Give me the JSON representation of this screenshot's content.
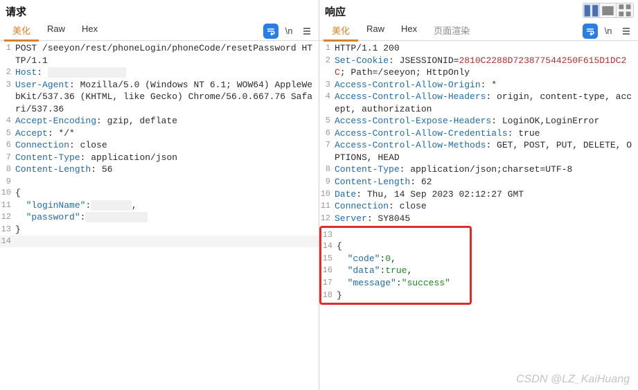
{
  "view_buttons": [
    "split",
    "single",
    "grid"
  ],
  "request": {
    "title": "请求",
    "tabs": [
      "美化",
      "Raw",
      "Hex"
    ],
    "active_tab": 0,
    "lines": [
      [
        {
          "t": "hlit",
          "v": "POST /seeyon/rest/phoneLogin/phoneCode/resetPassword HTTP/1.1"
        }
      ],
      [
        {
          "t": "hname",
          "v": "Host"
        },
        {
          "t": "hlit",
          "v": ": "
        },
        {
          "t": "blur",
          "v": "xxxxxxxxxxxxxx"
        }
      ],
      [
        {
          "t": "hname",
          "v": "User-Agent"
        },
        {
          "t": "hlit",
          "v": ": "
        },
        {
          "t": "hlit",
          "v": "Mozilla/5.0 (Windows NT 6.1; WOW64) AppleWebKit/537.36 (KHTML, like Gecko) Chrome/56.0.667.76 Safari/537.36"
        }
      ],
      [
        {
          "t": "hname",
          "v": "Accept-Encoding"
        },
        {
          "t": "hlit",
          "v": ": "
        },
        {
          "t": "hlit",
          "v": "gzip, deflate"
        }
      ],
      [
        {
          "t": "hname",
          "v": "Accept"
        },
        {
          "t": "hlit",
          "v": ": "
        },
        {
          "t": "hlit",
          "v": "*/*"
        }
      ],
      [
        {
          "t": "hname",
          "v": "Connection"
        },
        {
          "t": "hlit",
          "v": ": "
        },
        {
          "t": "hlit",
          "v": "close"
        }
      ],
      [
        {
          "t": "hname",
          "v": "Content-Type"
        },
        {
          "t": "hlit",
          "v": ": "
        },
        {
          "t": "hlit",
          "v": "application/json"
        }
      ],
      [
        {
          "t": "hname",
          "v": "Content-Length"
        },
        {
          "t": "hlit",
          "v": ": "
        },
        {
          "t": "hlit",
          "v": "56"
        }
      ],
      [
        {
          "t": "hlit",
          "v": ""
        }
      ],
      [
        {
          "t": "hlit",
          "v": "{"
        }
      ],
      [
        {
          "t": "hlit",
          "v": "  "
        },
        {
          "t": "hname",
          "v": "\"loginName\""
        },
        {
          "t": "hlit",
          "v": ":"
        },
        {
          "t": "blur",
          "v": "\"xxxxx\""
        },
        {
          "t": "hlit",
          "v": ","
        }
      ],
      [
        {
          "t": "hlit",
          "v": "  "
        },
        {
          "t": "hname",
          "v": "\"password\""
        },
        {
          "t": "hlit",
          "v": ":"
        },
        {
          "t": "blur",
          "v": "\"xxxxxxxxx\""
        }
      ],
      [
        {
          "t": "hlit",
          "v": "}"
        }
      ],
      [
        {
          "t": "hlit",
          "v": ""
        }
      ]
    ],
    "highlight_last": true
  },
  "response": {
    "title": "响应",
    "tabs": [
      "美化",
      "Raw",
      "Hex",
      "页面渲染"
    ],
    "active_tab": 0,
    "lines_head": [
      [
        {
          "t": "hlit",
          "v": "HTTP/1.1 200"
        }
      ],
      [
        {
          "t": "hname",
          "v": "Set-Cookie"
        },
        {
          "t": "hlit",
          "v": ": "
        },
        {
          "t": "hlit",
          "v": "JSESSIONID="
        },
        {
          "t": "hval",
          "v": "2810C2288D723877544250F615D1DC2C"
        },
        {
          "t": "hlit",
          "v": "; Path=/seeyon; HttpOnly"
        }
      ],
      [
        {
          "t": "hname",
          "v": "Access-Control-Allow-Origin"
        },
        {
          "t": "hlit",
          "v": ": "
        },
        {
          "t": "hlit",
          "v": "*"
        }
      ],
      [
        {
          "t": "hname",
          "v": "Access-Control-Allow-Headers"
        },
        {
          "t": "hlit",
          "v": ": "
        },
        {
          "t": "hlit",
          "v": "origin, content-type, accept, authorization"
        }
      ],
      [
        {
          "t": "hname",
          "v": "Access-Control-Expose-Headers"
        },
        {
          "t": "hlit",
          "v": ": "
        },
        {
          "t": "hlit",
          "v": "LoginOK,LoginError"
        }
      ],
      [
        {
          "t": "hname",
          "v": "Access-Control-Allow-Credentials"
        },
        {
          "t": "hlit",
          "v": ": "
        },
        {
          "t": "hlit",
          "v": "true"
        }
      ],
      [
        {
          "t": "hname",
          "v": "Access-Control-Allow-Methods"
        },
        {
          "t": "hlit",
          "v": ": "
        },
        {
          "t": "hlit",
          "v": "GET, POST, PUT, DELETE, OPTIONS, HEAD"
        }
      ],
      [
        {
          "t": "hname",
          "v": "Content-Type"
        },
        {
          "t": "hlit",
          "v": ": "
        },
        {
          "t": "hlit",
          "v": "application/json;charset=UTF-8"
        }
      ],
      [
        {
          "t": "hname",
          "v": "Content-Length"
        },
        {
          "t": "hlit",
          "v": ": "
        },
        {
          "t": "hlit",
          "v": "62"
        }
      ],
      [
        {
          "t": "hname",
          "v": "Date"
        },
        {
          "t": "hlit",
          "v": ": "
        },
        {
          "t": "hlit",
          "v": "Thu, 14 Sep 2023 02:12:27 GMT"
        }
      ],
      [
        {
          "t": "hname",
          "v": "Connection"
        },
        {
          "t": "hlit",
          "v": ": "
        },
        {
          "t": "hlit",
          "v": "close"
        }
      ],
      [
        {
          "t": "hname",
          "v": "Server"
        },
        {
          "t": "hlit",
          "v": ": "
        },
        {
          "t": "hlit",
          "v": "SY8045"
        }
      ]
    ],
    "lines_body": [
      [
        {
          "t": "hlit",
          "v": ""
        }
      ],
      [
        {
          "t": "hlit",
          "v": "{"
        }
      ],
      [
        {
          "t": "hlit",
          "v": "  "
        },
        {
          "t": "hname",
          "v": "\"code\""
        },
        {
          "t": "hlit",
          "v": ":"
        },
        {
          "t": "num",
          "v": "0"
        },
        {
          "t": "hlit",
          "v": ","
        }
      ],
      [
        {
          "t": "hlit",
          "v": "  "
        },
        {
          "t": "hname",
          "v": "\"data\""
        },
        {
          "t": "hlit",
          "v": ":"
        },
        {
          "t": "num",
          "v": "true"
        },
        {
          "t": "hlit",
          "v": ","
        }
      ],
      [
        {
          "t": "hlit",
          "v": "  "
        },
        {
          "t": "hname",
          "v": "\"message\""
        },
        {
          "t": "hlit",
          "v": ":"
        },
        {
          "t": "str",
          "v": "\"success\""
        }
      ],
      [
        {
          "t": "hlit",
          "v": "}"
        }
      ]
    ]
  },
  "watermark": "CSDN @LZ_KaiHuang"
}
